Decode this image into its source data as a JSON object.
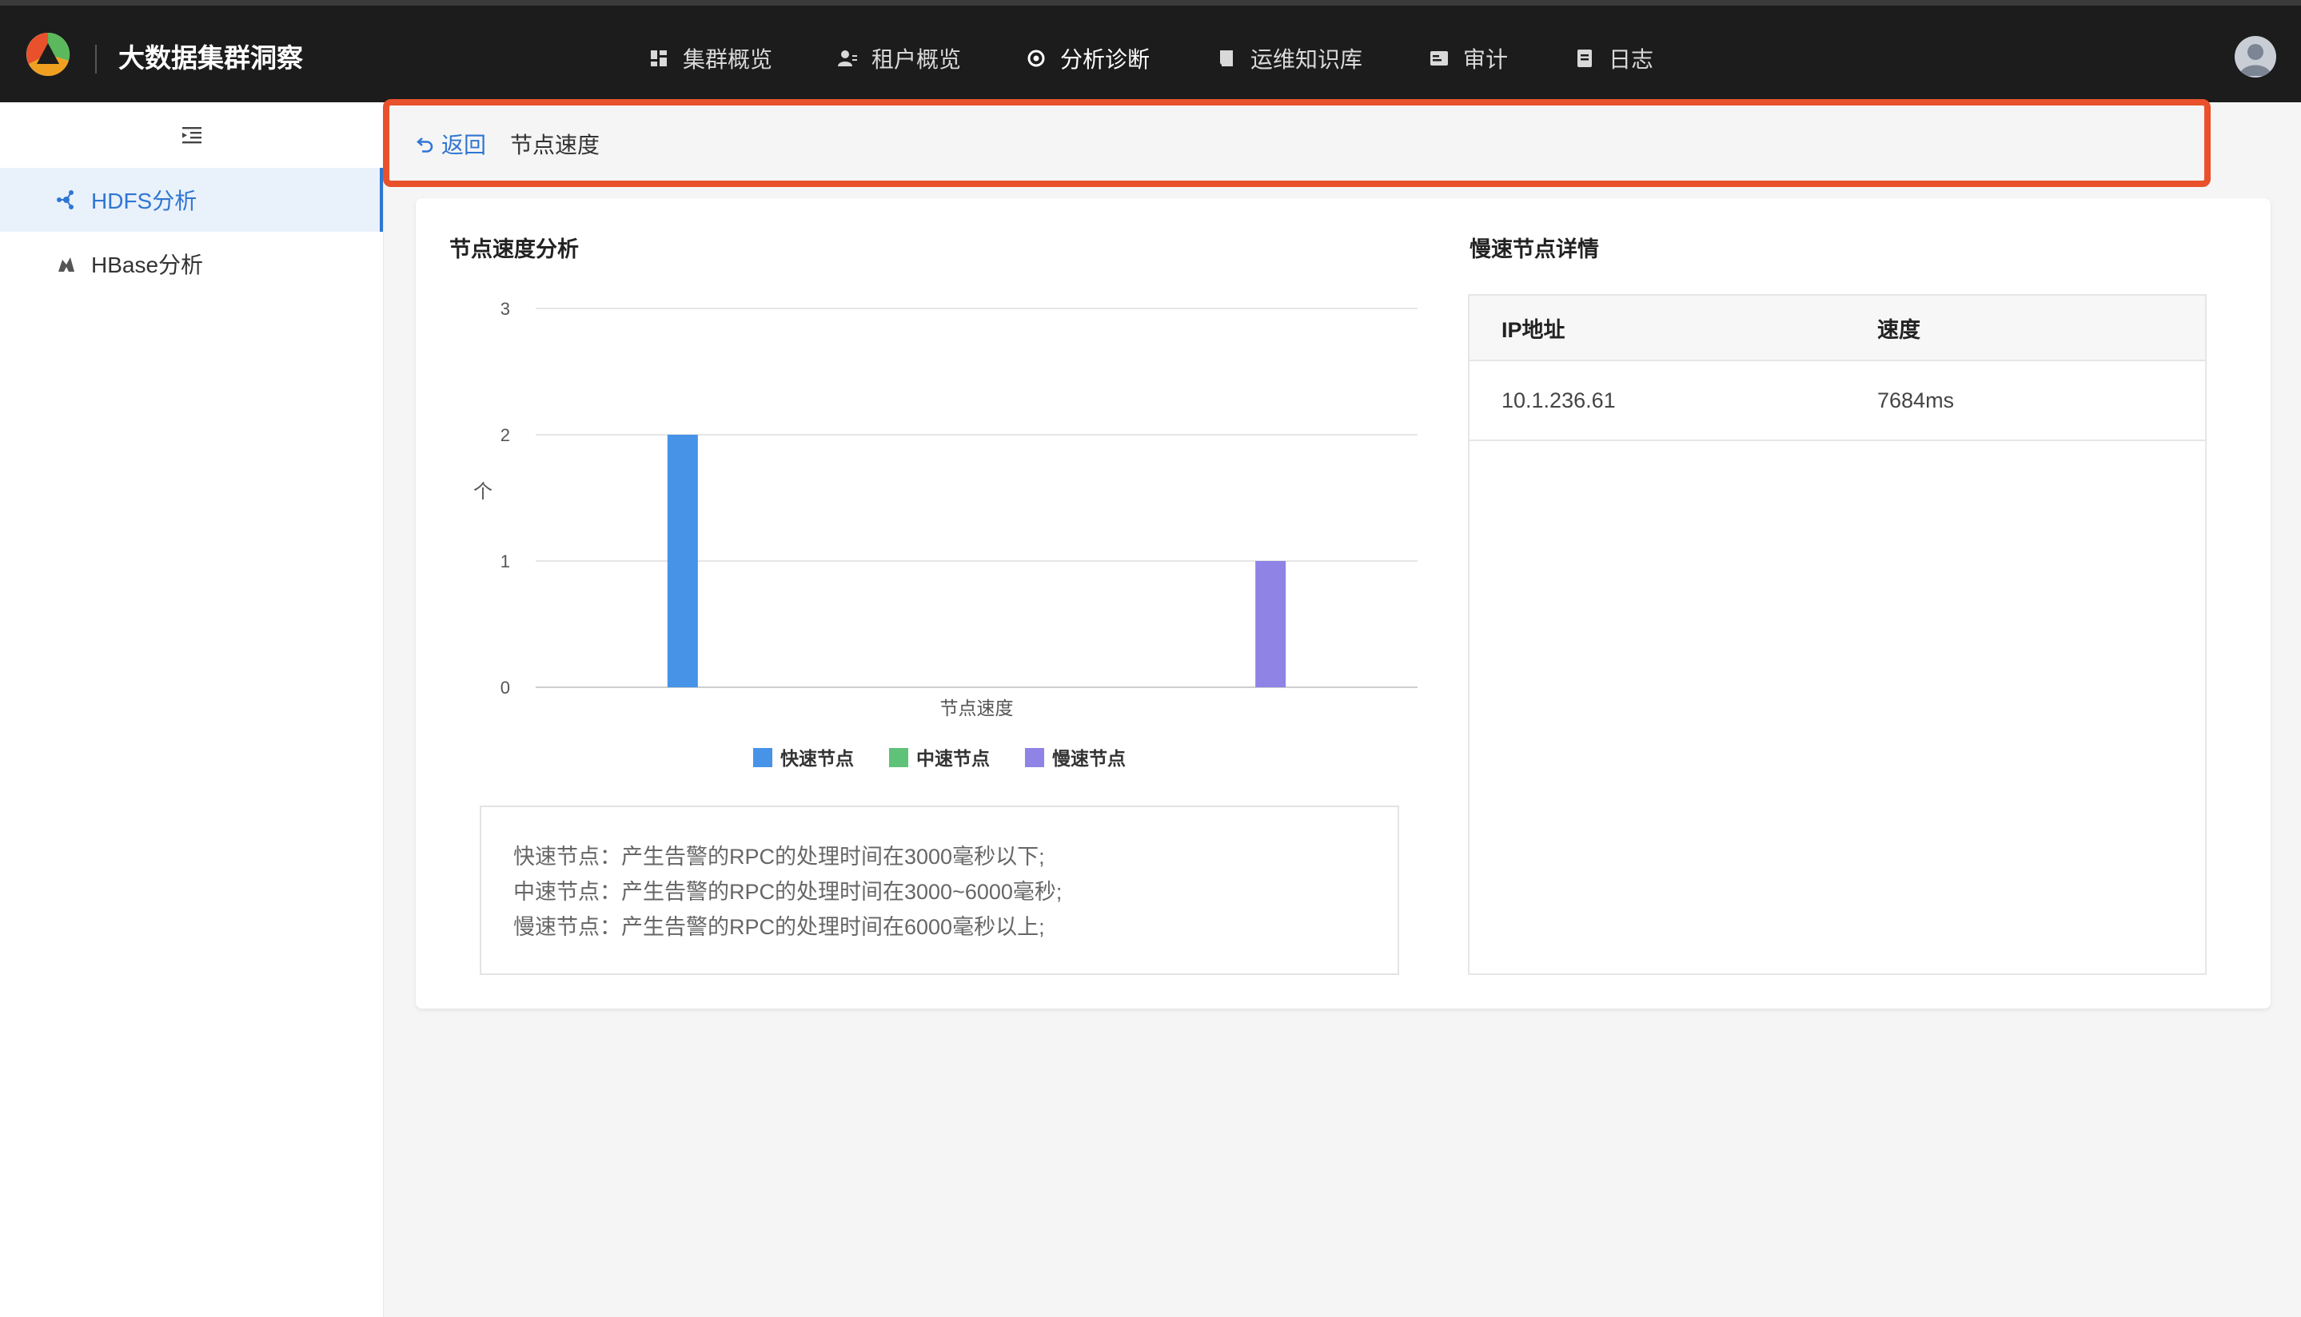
{
  "app": {
    "title": "大数据集群洞察"
  },
  "nav": {
    "items": [
      {
        "label": "集群概览",
        "icon": "dashboard-icon",
        "active": false
      },
      {
        "label": "租户概览",
        "icon": "tenant-icon",
        "active": false
      },
      {
        "label": "分析诊断",
        "icon": "diagnosis-icon",
        "active": true
      },
      {
        "label": "运维知识库",
        "icon": "book-icon",
        "active": false
      },
      {
        "label": "审计",
        "icon": "audit-icon",
        "active": false
      },
      {
        "label": "日志",
        "icon": "log-icon",
        "active": false
      }
    ]
  },
  "sidebar": {
    "items": [
      {
        "label": "HDFS分析",
        "icon": "hdfs-icon",
        "active": true
      },
      {
        "label": "HBase分析",
        "icon": "hbase-icon",
        "active": false
      }
    ]
  },
  "breadcrumb": {
    "back_label": "返回",
    "current": "节点速度"
  },
  "chart_section": {
    "title": "节点速度分析"
  },
  "chart_data": {
    "type": "bar",
    "categories": [
      "节点速度"
    ],
    "series": [
      {
        "name": "快速节点",
        "values": [
          2
        ],
        "color": "#4693e8"
      },
      {
        "name": "中速节点",
        "values": [
          0
        ],
        "color": "#5fc279"
      },
      {
        "name": "慢速节点",
        "values": [
          1
        ],
        "color": "#8f83e6"
      }
    ],
    "xlabel": "节点速度",
    "ylabel": "个",
    "ylim": [
      0,
      3
    ],
    "yticks": [
      "0",
      "1",
      "2",
      "3"
    ],
    "grid": true,
    "legend": "bottom"
  },
  "notes": [
    "快速节点：产生告警的RPC的处理时间在3000毫秒以下;",
    "中速节点：产生告警的RPC的处理时间在3000~6000毫秒;",
    "慢速节点：产生告警的RPC的处理时间在6000毫秒以上;"
  ],
  "slow_nodes": {
    "title": "慢速节点详情",
    "columns": [
      "IP地址",
      "速度"
    ],
    "rows": [
      [
        "10.1.236.61",
        "7684ms"
      ]
    ]
  }
}
